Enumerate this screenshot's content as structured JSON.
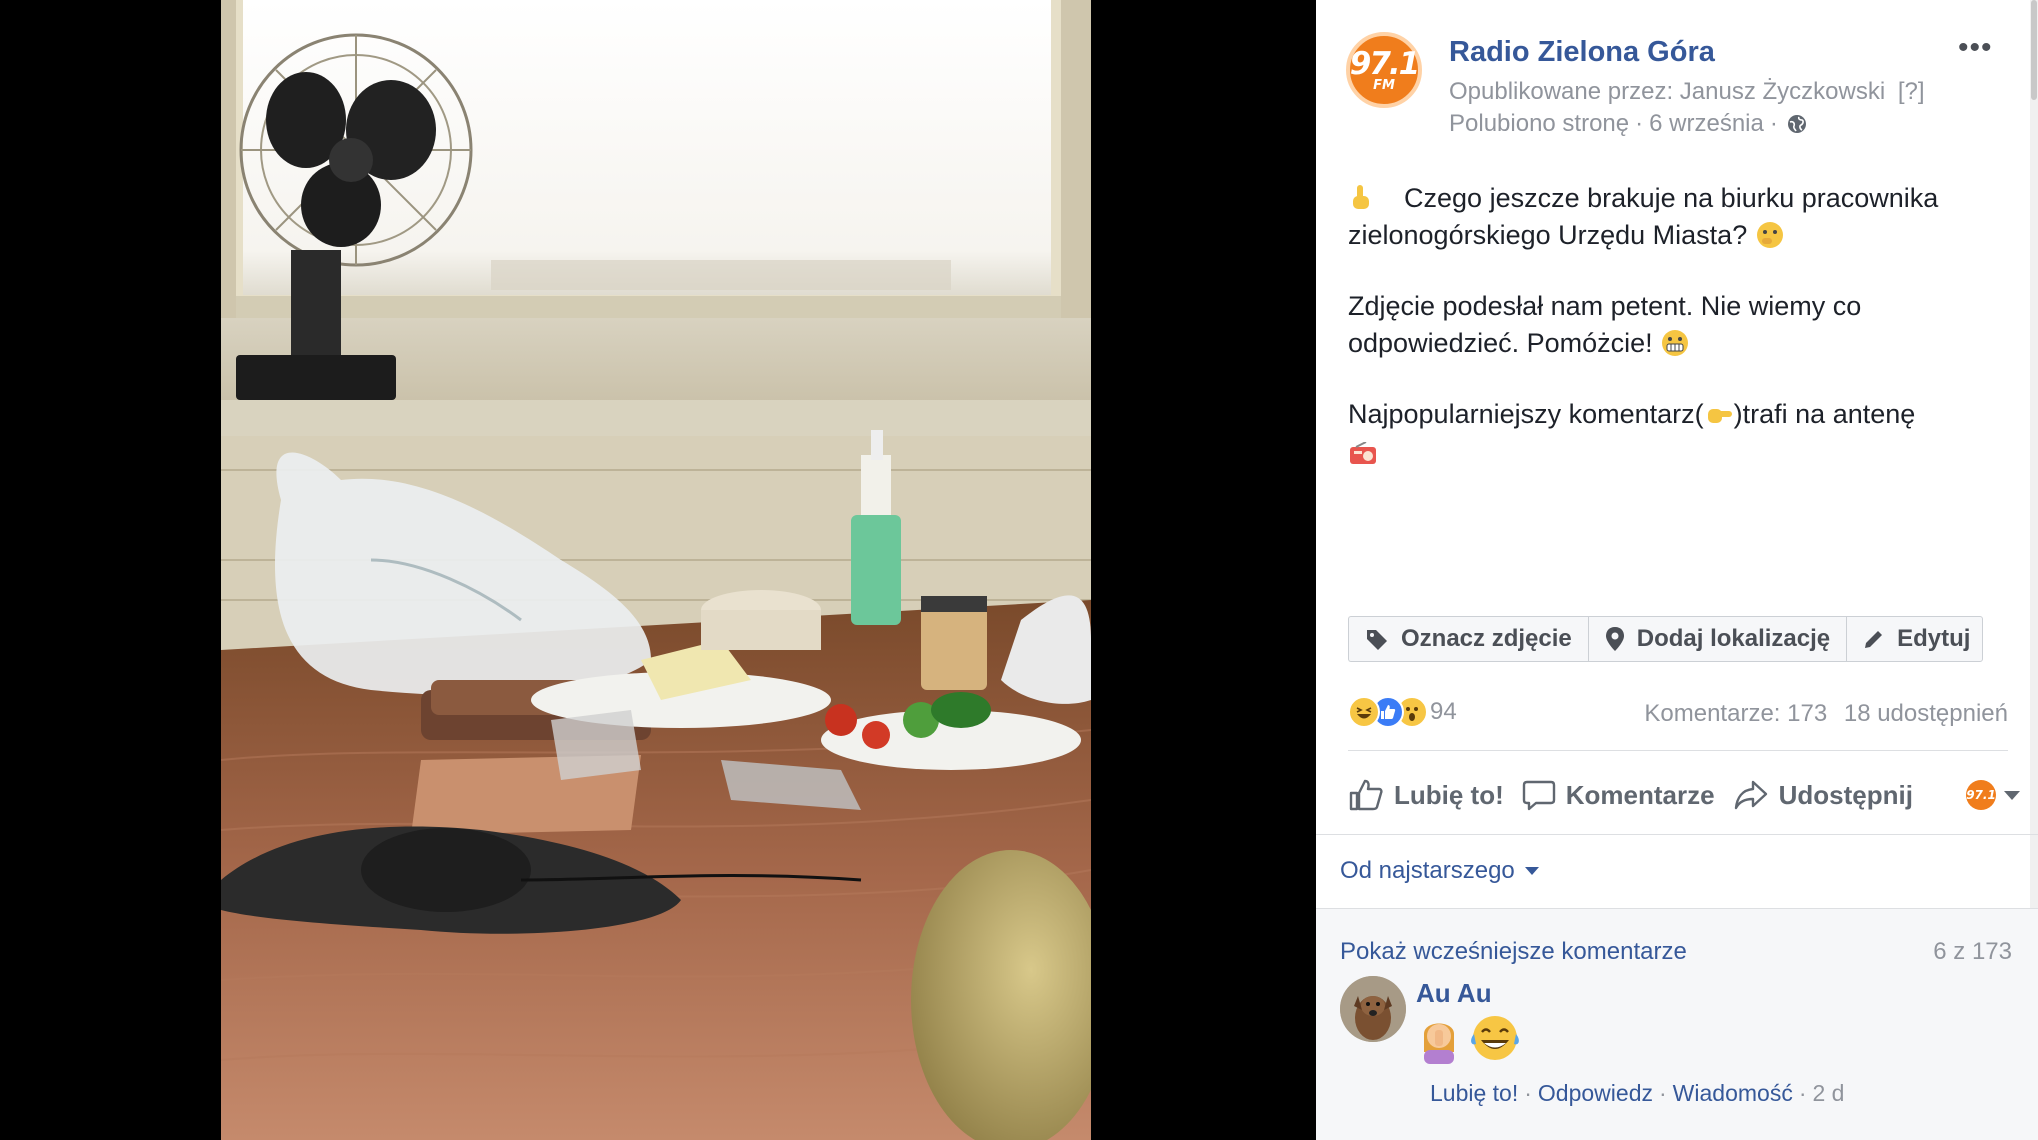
{
  "post": {
    "page_name": "Radio Zielona Góra",
    "logo": {
      "main": "97.1",
      "sub": "FM"
    },
    "published_by": "Opublikowane przez: Janusz Życzkowski",
    "help_marker": "[?]",
    "liked_label": "Polubiono stronę",
    "date": "6 września",
    "more_icon": "•••",
    "text": {
      "line1": "Czego jeszcze brakuje na biurku pracownika zielonogórskiego Urzędu Miasta?",
      "line2": "Zdjęcie podesłał nam petent. Nie wiemy co odpowiedzieć. Pomóżcie!",
      "line3_before": "Najpopularniejszy komentarz(",
      "line3_after": ")trafi na antenę"
    }
  },
  "photo_actions": {
    "tag": "Oznacz zdjęcie",
    "location": "Dodaj lokalizację",
    "edit": "Edytuj"
  },
  "stats": {
    "reaction_count": "94",
    "comments": "Komentarze: 173",
    "shares": "18 udostępnień"
  },
  "actions": {
    "like": "Lubię to!",
    "comment": "Komentarze",
    "share": "Udostępnij"
  },
  "comments": {
    "sort_label": "Od najstarszego",
    "show_previous": "Pokaż wcześniejsze komentarze",
    "count": "6 z 173",
    "items": [
      {
        "author": "Au Au",
        "like": "Lubię to!",
        "reply": "Odpowiedz",
        "message": "Wiadomość",
        "age": "2 d"
      }
    ]
  },
  "colors": {
    "link_blue": "#365899",
    "brand_orange": "#f07d1c",
    "muted_grey": "#90949c"
  },
  "icons": [
    "ellipsis-icon",
    "globe-icon",
    "tag-icon",
    "pin-icon",
    "pencil-icon",
    "like-icon",
    "comment-icon",
    "share-icon",
    "haha-reaction-icon",
    "like-reaction-icon",
    "wow-reaction-icon"
  ]
}
